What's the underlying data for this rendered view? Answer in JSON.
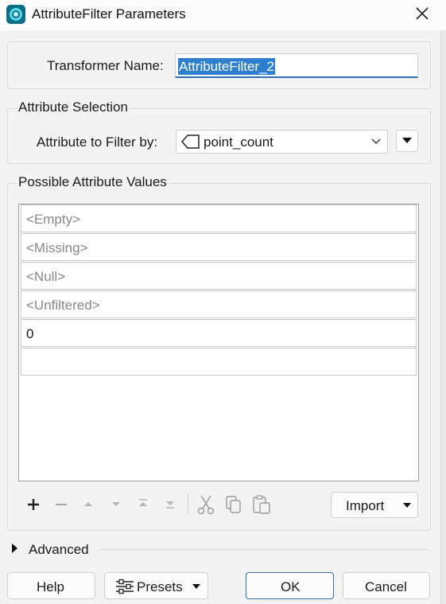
{
  "window": {
    "title": "AttributeFilter Parameters"
  },
  "transformer": {
    "label": "Transformer Name:",
    "value": "AttributeFilter_2"
  },
  "attribute_selection": {
    "legend": "Attribute Selection",
    "label": "Attribute to Filter by:",
    "selected": "point_count"
  },
  "possible_values": {
    "legend": "Possible Attribute Values",
    "rows": [
      "<Empty>",
      "<Missing>",
      "<Null>",
      "<Unfiltered>",
      "0",
      ""
    ]
  },
  "toolbar": {
    "icons": [
      "add-icon",
      "remove-icon",
      "move-up-icon",
      "move-down-icon",
      "move-top-icon",
      "move-bottom-icon",
      "cut-icon",
      "copy-icon",
      "paste-icon"
    ],
    "import_label": "Import"
  },
  "advanced": {
    "label": "Advanced"
  },
  "footer": {
    "help": "Help",
    "presets": "Presets",
    "ok": "OK",
    "cancel": "Cancel"
  },
  "colors": {
    "accent": "#2f6fb3",
    "selection": "#2f7fd1",
    "app_icon": "#0b6f86"
  }
}
